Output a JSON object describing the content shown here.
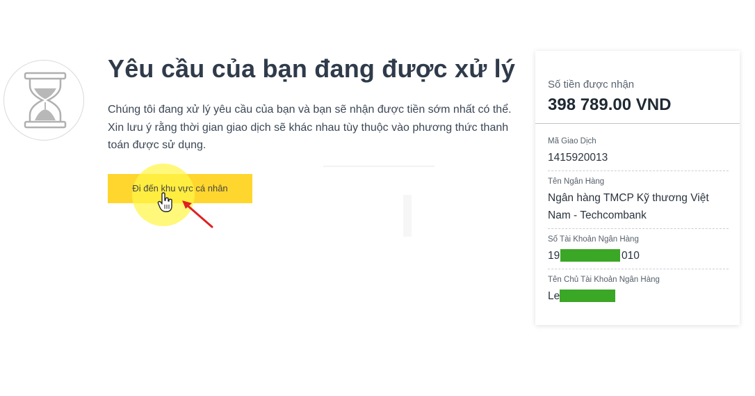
{
  "status": {
    "title": "Yêu cầu của bạn đang được xử lý",
    "description": "Chúng tôi đang xử lý yêu cầu của bạn và bạn sẽ nhận được tiền sớm nhất có thể. Xin lưu ý rằng thời gian giao dịch sẽ khác nhau tùy thuộc vào phương thức thanh toán được sử dụng.",
    "icon": "hourglass-icon",
    "cta_label": "Đi đến khu vực cá nhân"
  },
  "summary": {
    "amount_label": "Số tiền được nhận",
    "amount_value": "398 789.00 VND",
    "details": [
      {
        "label": "Mã Giao Dịch",
        "value": "1415920013"
      },
      {
        "label": "Tên Ngân Hàng",
        "value": "Ngân hàng TMCP Kỹ thương Việt Nam - Techcombank"
      },
      {
        "label": "Số Tài Khoản Ngân Hàng",
        "value_prefix": "19",
        "value_suffix": "010"
      },
      {
        "label": "Tên Chủ Tài Khoản Ngân Hàng",
        "value_prefix": "Le",
        "value_suffix": ""
      }
    ]
  },
  "colors": {
    "button": "#ffd62e",
    "click_highlight": "#fff546",
    "mask": "#3ba727",
    "arrow": "#e02020"
  }
}
